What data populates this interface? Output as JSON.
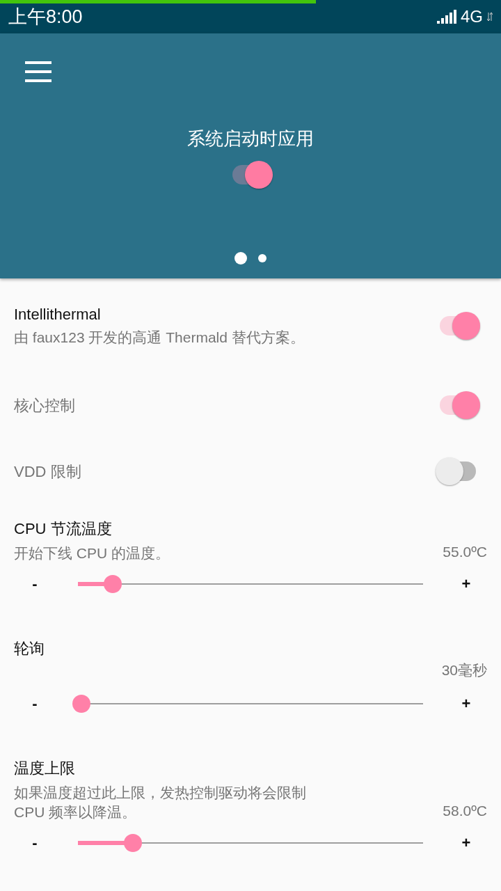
{
  "status_bar": {
    "time": "上午8:00",
    "network": "4G",
    "load_progress": {
      "level": 0.63
    }
  },
  "header": {
    "title": "系统启动时应用",
    "switch": {
      "on": true
    },
    "pages": [
      {
        "selected": true
      },
      {
        "selected": false
      }
    ]
  },
  "settings": [
    {
      "kind": "switch",
      "title": "Intellithermal",
      "description": "由 faux123 开发的高通 Thermald 替代方案。",
      "on": true
    },
    {
      "kind": "switch",
      "title": "核心控制",
      "on": true
    },
    {
      "kind": "switch",
      "title": "VDD 限制",
      "on": false
    },
    {
      "kind": "slider",
      "title": "CPU 节流温度",
      "description": "开始下线 CPU 的温度。",
      "value": "55.0ºC",
      "minus": "-",
      "plus": "+",
      "level": 0.1
    },
    {
      "kind": "slider",
      "title": "轮询",
      "value": "30毫秒",
      "minus": "-",
      "plus": "+",
      "level": 0.01
    },
    {
      "kind": "slider",
      "title": "温度上限",
      "description": "如果温度超过此上限，发热控制驱动将会限制\nCPU 频率以降温。",
      "value": "58.0ºC",
      "minus": "-",
      "plus": "+",
      "level": 0.16
    }
  ]
}
